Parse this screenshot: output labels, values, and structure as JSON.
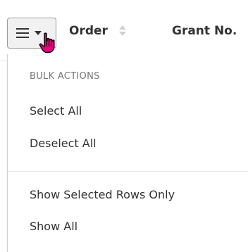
{
  "table_header": {
    "columns": [
      {
        "label": "Order",
        "sortable": true
      },
      {
        "label": "Grant No.",
        "sortable": false
      }
    ]
  },
  "menu_toggle": {
    "icon": "hamburger-icon",
    "dropdown_icon": "caret-down-icon",
    "cursor_icon": "hand-pointer-icon"
  },
  "dropdown": {
    "section_header": "BULK ACTIONS",
    "items": [
      {
        "label": "Select All"
      },
      {
        "label": "Deselect All"
      },
      {
        "label": "Show Selected Rows Only"
      },
      {
        "label": "Show All"
      }
    ]
  },
  "colors": {
    "button_background": "#f1f1f1",
    "button_border": "#9b9b9b",
    "text": "#333333",
    "muted_text": "#777777",
    "cursor_pink": "#e6007e"
  }
}
